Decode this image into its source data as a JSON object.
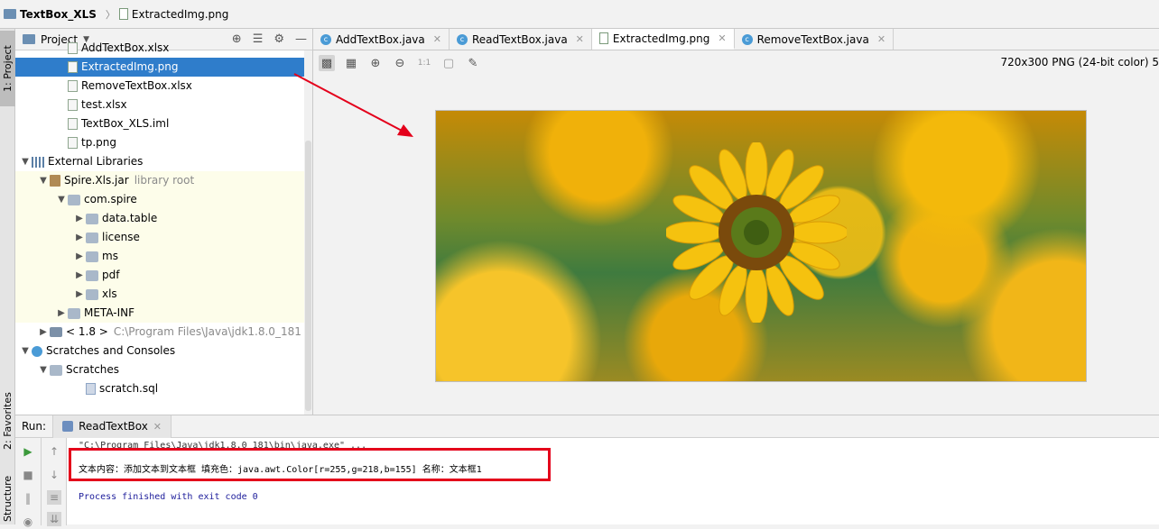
{
  "breadcrumb": {
    "project": "TextBox_XLS",
    "file": "ExtractedImg.png"
  },
  "left_strip": {
    "project_tab": "1: Project",
    "favorites_tab": "2: Favorites",
    "structure_tab": "Structure"
  },
  "project_panel": {
    "title": "Project",
    "tree": [
      {
        "label": "AddTextBox.xlsx",
        "level": 2,
        "icon": "file"
      },
      {
        "label": "ExtractedImg.png",
        "level": 2,
        "icon": "file",
        "selected": true
      },
      {
        "label": "RemoveTextBox.xlsx",
        "level": 2,
        "icon": "file"
      },
      {
        "label": "test.xlsx",
        "level": 2,
        "icon": "file"
      },
      {
        "label": "TextBox_XLS.iml",
        "level": 2,
        "icon": "file"
      },
      {
        "label": "tp.png",
        "level": 2,
        "icon": "file"
      },
      {
        "label": "External Libraries",
        "level": 0,
        "icon": "lib",
        "expanded": true
      },
      {
        "label": "Spire.Xls.jar",
        "note": "library root",
        "level": 1,
        "icon": "jar",
        "expanded": true,
        "lib": true
      },
      {
        "label": "com.spire",
        "level": 2,
        "icon": "pkg",
        "expanded": true,
        "lib": true
      },
      {
        "label": "data.table",
        "level": 3,
        "icon": "pkg",
        "collapsed": true,
        "lib": true
      },
      {
        "label": "license",
        "level": 3,
        "icon": "pkg",
        "collapsed": true,
        "lib": true
      },
      {
        "label": "ms",
        "level": 3,
        "icon": "pkg",
        "collapsed": true,
        "lib": true
      },
      {
        "label": "pdf",
        "level": 3,
        "icon": "pkg",
        "collapsed": true,
        "lib": true
      },
      {
        "label": "xls",
        "level": 3,
        "icon": "pkg",
        "collapsed": true,
        "lib": true
      },
      {
        "label": "META-INF",
        "level": 2,
        "icon": "pkg",
        "collapsed": true,
        "lib": true
      },
      {
        "label": "< 1.8 >",
        "note": "C:\\Program Files\\Java\\jdk1.8.0_181",
        "level": 1,
        "icon": "jdk",
        "collapsed": true
      },
      {
        "label": "Scratches and Consoles",
        "level": 0,
        "icon": "scratch",
        "expanded": true
      },
      {
        "label": "Scratches",
        "level": 1,
        "icon": "pkg",
        "expanded": true
      },
      {
        "label": "scratch.sql",
        "level": 3,
        "icon": "sql"
      }
    ]
  },
  "editor": {
    "tabs": [
      {
        "label": "AddTextBox.java",
        "icon": "c"
      },
      {
        "label": "ReadTextBox.java",
        "icon": "c"
      },
      {
        "label": "ExtractedImg.png",
        "icon": "p",
        "active": true
      },
      {
        "label": "RemoveTextBox.java",
        "icon": "c"
      }
    ],
    "image_info": "720x300 PNG (24-bit color) 5",
    "zoom_label": "1:1"
  },
  "run": {
    "label": "Run:",
    "tab": "ReadTextBox",
    "console_cmd": "\"C:\\Program Files\\Java\\jdk1.8.0_181\\bin\\java.exe\" ...",
    "console_output": "文本内容：添加文本到文本框 填充色：java.awt.Color[r=255,g=218,b=155] 名称：文本框1",
    "console_exit": "Process finished with exit code 0"
  },
  "colors": {
    "selection": "#2f7dcb",
    "annotation": "#e4001b",
    "library_bg": "#fdfdea"
  }
}
